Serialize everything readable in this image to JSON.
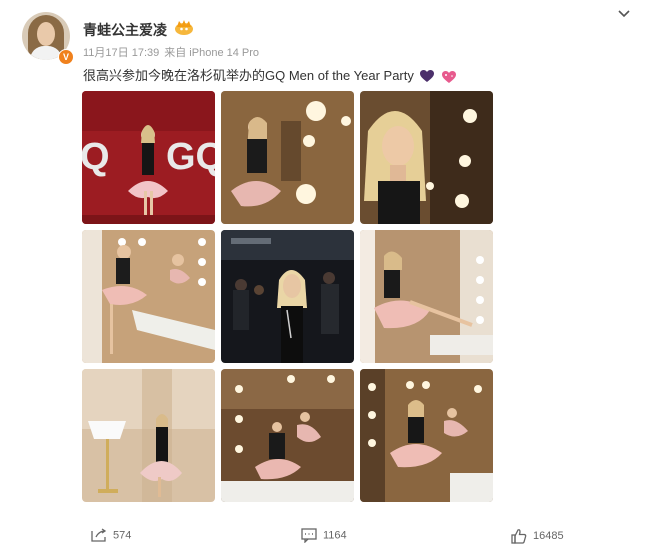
{
  "post": {
    "username": "青蛙公主爱凌",
    "date": "11月17日 17:39",
    "source": "来自 iPhone 14 Pro",
    "text": "很高兴参加今晚在洛杉矶举办的GQ Men of the Year Party",
    "verified_label": "V",
    "emojis": [
      "purple-heart-icon",
      "sparkling-heart-icon"
    ]
  },
  "images": [
    {
      "name": "photo-gq-red-backdrop"
    },
    {
      "name": "photo-mirror-lights-seated"
    },
    {
      "name": "photo-mirror-closeup"
    },
    {
      "name": "photo-vanity-seated"
    },
    {
      "name": "photo-party-crowd"
    },
    {
      "name": "photo-vanity-legs-up"
    },
    {
      "name": "photo-room-lamp-standing"
    },
    {
      "name": "photo-mirror-two-reflections"
    },
    {
      "name": "photo-vanity-reflection"
    }
  ],
  "actions": {
    "repost_count": "574",
    "comment_count": "1164",
    "like_count": "16485"
  },
  "colors": {
    "accent_orange": "#f0811d",
    "text_primary": "#333333",
    "text_meta": "#999999"
  }
}
